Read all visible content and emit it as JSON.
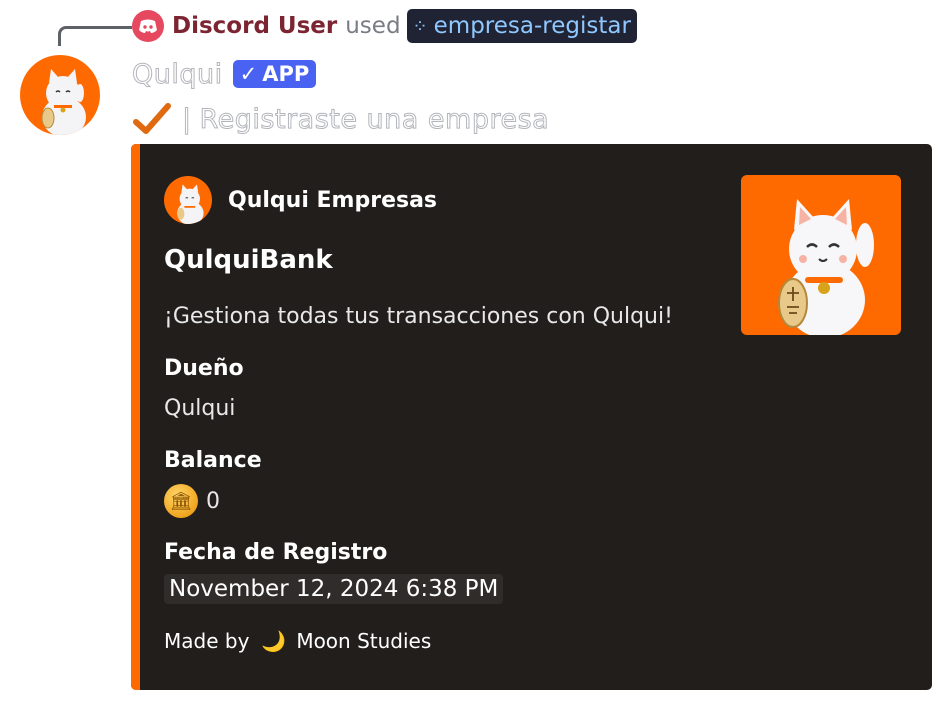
{
  "reply": {
    "user": "Discord User",
    "used_text": "used",
    "command": "empresa-registar",
    "user_icon": "discord-logo-icon",
    "command_icon": "slash-command-icon"
  },
  "message": {
    "bot_name": "Qulqui",
    "badge_label": "APP",
    "content_separator": "|",
    "content": "Registraste una empresa",
    "content_icon": "check-mark-icon"
  },
  "embed": {
    "accent_color": "#ff6a00",
    "author_name": "Qulqui Empresas",
    "title": "QulquiBank",
    "description": "¡Gestiona todas tus transacciones con Qulqui!",
    "fields": [
      {
        "name": "Dueño",
        "value": "Qulqui"
      },
      {
        "name": "Balance",
        "value": "0",
        "icon": "coin-icon"
      },
      {
        "name": "Fecha de Registro",
        "value": "November 12, 2024 6:38 PM"
      }
    ],
    "footer": {
      "prefix": "Made by",
      "icon": "crescent-moon-icon",
      "name": "Moon Studies"
    }
  }
}
